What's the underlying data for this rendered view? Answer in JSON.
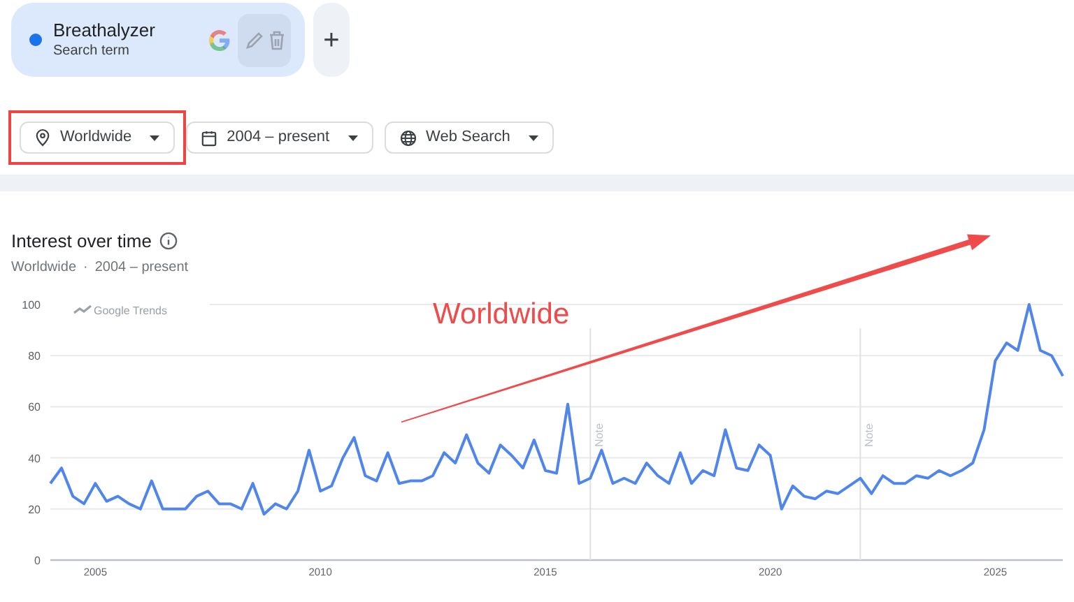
{
  "search_term": {
    "label": "Breathalyzer",
    "sublabel": "Search term",
    "color": "#1a73e8"
  },
  "add_button": {
    "label": "+"
  },
  "filters": [
    {
      "kind": "location",
      "label": "Worldwide",
      "highlighted": true
    },
    {
      "kind": "date",
      "label": "2004 – present",
      "highlighted": false
    },
    {
      "kind": "web",
      "label": "Web Search",
      "highlighted": false
    }
  ],
  "panel": {
    "title": "Interest over time",
    "subtitle_location": "Worldwide",
    "subtitle_separator": "·",
    "subtitle_range": "2004 – present",
    "chart_badge": "Google Trends",
    "chart_data": {
      "type": "line",
      "x": [
        2004,
        2004.25,
        2004.5,
        2004.75,
        2005,
        2005.25,
        2005.5,
        2005.75,
        2006,
        2006.25,
        2006.5,
        2006.75,
        2007,
        2007.25,
        2007.5,
        2007.75,
        2008,
        2008.25,
        2008.5,
        2008.75,
        2009,
        2009.25,
        2009.5,
        2009.75,
        2010,
        2010.25,
        2010.5,
        2010.75,
        2011,
        2011.25,
        2011.5,
        2011.75,
        2012,
        2012.25,
        2012.5,
        2012.75,
        2013,
        2013.25,
        2013.5,
        2013.75,
        2014,
        2014.25,
        2014.5,
        2014.75,
        2015,
        2015.25,
        2015.5,
        2015.75,
        2016,
        2016.25,
        2016.5,
        2016.75,
        2017,
        2017.25,
        2017.5,
        2017.75,
        2018,
        2018.25,
        2018.5,
        2018.75,
        2019,
        2019.25,
        2019.5,
        2019.75,
        2020,
        2020.25,
        2020.5,
        2020.75,
        2021,
        2021.25,
        2021.5,
        2021.75,
        2022,
        2022.25,
        2022.5,
        2022.75,
        2023,
        2023.25,
        2023.5,
        2023.75,
        2024,
        2024.25,
        2024.5,
        2024.75,
        2025,
        2025.25,
        2025.5,
        2025.75,
        2026,
        2026.25,
        2026.5
      ],
      "series": [
        {
          "color": "#5086ec",
          "values": [
            30,
            36,
            25,
            22,
            30,
            23,
            25,
            22,
            20,
            31,
            20,
            20,
            20,
            25,
            27,
            22,
            22,
            20,
            30,
            18,
            22,
            20,
            27,
            43,
            27,
            29,
            40,
            48,
            33,
            31,
            42,
            30,
            31,
            31,
            33,
            42,
            38,
            49,
            38,
            34,
            45,
            41,
            36,
            47,
            35,
            34,
            61,
            30,
            32,
            43,
            30,
            32,
            30,
            38,
            33,
            30,
            42,
            30,
            35,
            33,
            51,
            36,
            35,
            45,
            41,
            20,
            29,
            25,
            24,
            27,
            26,
            29,
            32,
            26,
            33,
            30,
            30,
            33,
            32,
            35,
            33,
            35,
            38,
            51,
            78,
            85,
            82,
            100,
            82,
            80,
            72
          ]
        }
      ],
      "xlim": [
        2004,
        2026.5
      ],
      "ylim": [
        0,
        100
      ],
      "xticks": [
        2005,
        2010,
        2015,
        2020,
        2025
      ],
      "yticks": [
        0,
        20,
        40,
        60,
        80,
        100
      ],
      "grid": true,
      "ref_lines": [
        {
          "axis": "x",
          "value": 2016,
          "label": "Note"
        },
        {
          "axis": "x",
          "value": 2022,
          "label": "Note"
        }
      ],
      "annotations": [
        "Worldwide"
      ]
    }
  }
}
